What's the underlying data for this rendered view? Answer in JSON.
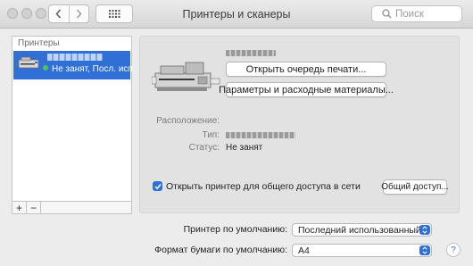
{
  "window": {
    "title": "Принтеры и сканеры"
  },
  "search": {
    "placeholder": "Поиск"
  },
  "sidebar": {
    "header": "Принтеры",
    "printers": [
      {
        "status": "Не занят, Посл. исп.",
        "status_color": "#51c15a"
      }
    ],
    "add_label": "+",
    "remove_label": "−"
  },
  "detail": {
    "open_queue_label": "Открыть очередь печати...",
    "options_label": "Параметры и расходные материалы...",
    "location_label": "Расположение:",
    "type_label": "Тип:",
    "status_label": "Статус:",
    "status_value": "Не занят",
    "share_checkbox_label": "Открыть принтер для общего доступа в сети",
    "share_checked": true,
    "sharing_button_label": "Общий доступ..."
  },
  "defaults": {
    "printer_label": "Принтер по умолчанию:",
    "printer_value": "Последний использованный",
    "paper_label": "Формат бумаги по умолчанию:",
    "paper_value": "A4"
  },
  "help": {
    "label": "?"
  },
  "colors": {
    "accent": "#2f6fd6"
  }
}
